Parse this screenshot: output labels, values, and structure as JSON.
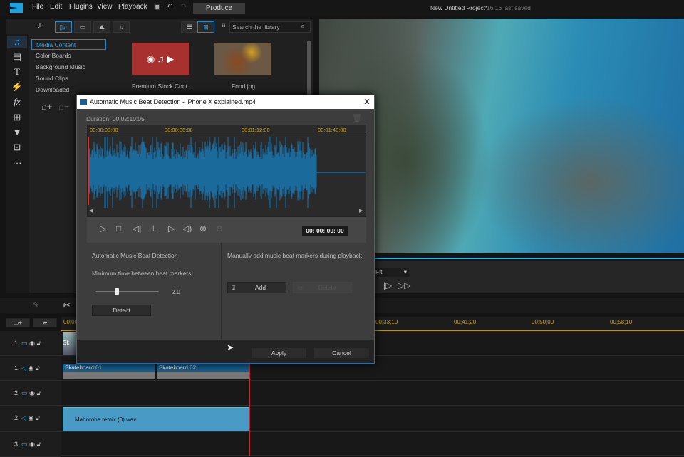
{
  "app": {
    "menu": [
      "File",
      "Edit",
      "Plugins",
      "View",
      "Playback"
    ],
    "produce": "Produce",
    "project_title": "New Untitled Project*",
    "saved": "16:16 last saved"
  },
  "library": {
    "search_placeholder": "Search the library",
    "categories": [
      "Media Content",
      "Color Boards",
      "Background Music",
      "Sound Clips",
      "Downloaded"
    ],
    "items": [
      {
        "label": "Premium Stock Cont..."
      },
      {
        "label": "Food.jpg"
      }
    ]
  },
  "preview": {
    "fit": "Fit"
  },
  "dialog": {
    "title": "Automatic Music Beat Detection - iPhone X explained.mp4",
    "duration": "Duration: 00:02:10:05",
    "ruler": [
      "00:00:00:00",
      "00:00:36:00",
      "00:01:12:00",
      "00:01:48:00"
    ],
    "timecode": "00: 00: 00: 00",
    "auto_heading": "Automatic Music Beat Detection",
    "min_time_label": "Minimum time between beat markers",
    "slider_value": "2.0",
    "slider_fraction": 0.33,
    "detect": "Detect",
    "manual_heading": "Manually add music beat markers during playback",
    "add": "Add",
    "delete": "Delete",
    "apply": "Apply",
    "cancel": "Cancel"
  },
  "timeline": {
    "ruler": [
      "00;00",
      "00;33;10",
      "00;41;20",
      "00;50;00",
      "00;58;10"
    ],
    "tracks": [
      "1.",
      "1.",
      "2.",
      "2.",
      "3."
    ],
    "clips": {
      "video1": "Sk",
      "audio1a": "Skateboard 01",
      "audio1b": "Skateboard 02",
      "audio2": "Mahoroba remix (0).wav"
    }
  }
}
